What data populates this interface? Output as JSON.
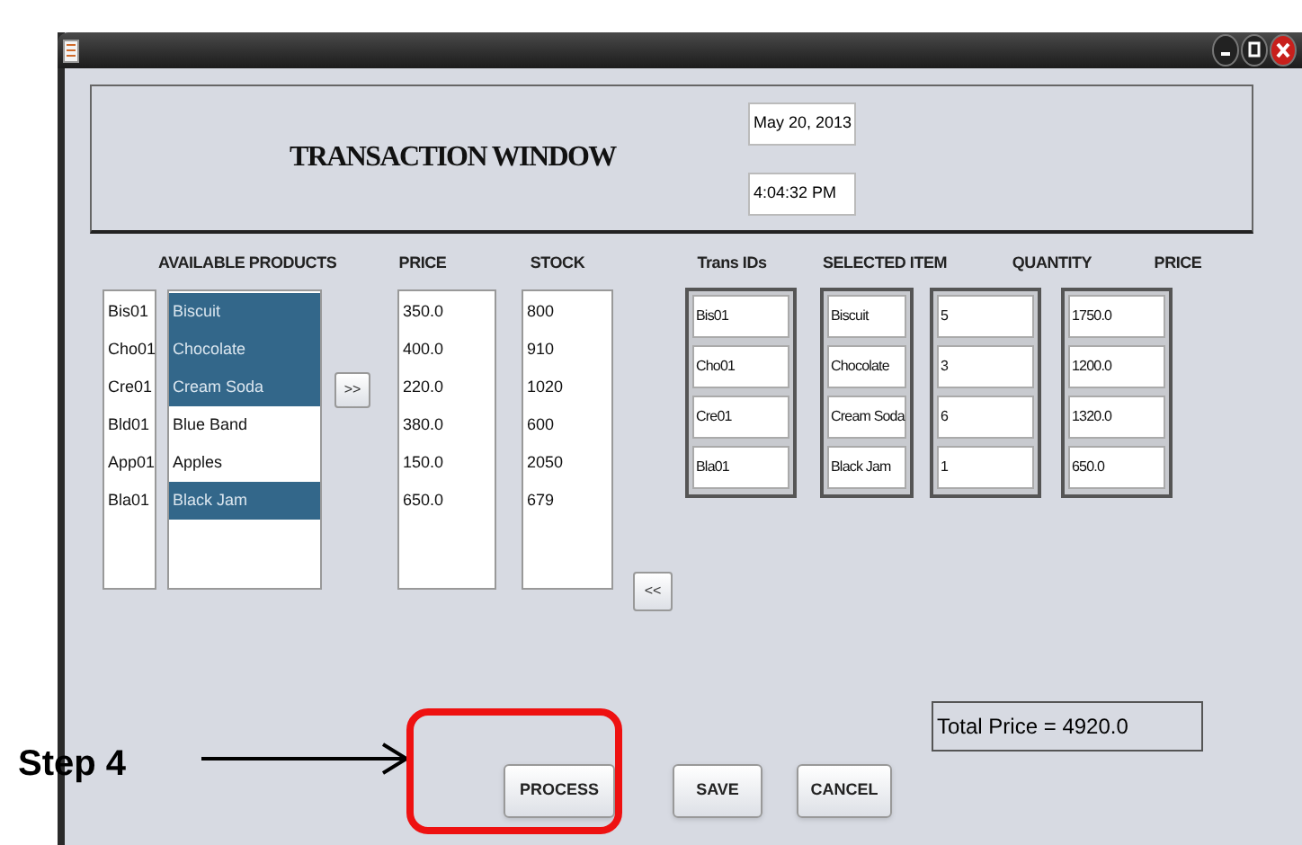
{
  "header": {
    "title": "TRANSACTION WINDOW",
    "date": "May 20, 2013",
    "time": "4:04:32 PM"
  },
  "headers": [
    "AVAILABLE PRODUCTS",
    "PRICE",
    "STOCK",
    "Trans IDs",
    "SELECTED ITEM",
    "QUANTITY",
    "PRICE"
  ],
  "products": [
    {
      "id": "Bis01",
      "name": "Biscuit",
      "selected": true,
      "price": "350.0",
      "stock": "800"
    },
    {
      "id": "Cho01",
      "name": "Chocolate",
      "selected": true,
      "price": "400.0",
      "stock": "910"
    },
    {
      "id": "Cre01",
      "name": "Cream Soda",
      "selected": true,
      "price": "220.0",
      "stock": "1020"
    },
    {
      "id": "Bld01",
      "name": "Blue Band",
      "selected": false,
      "price": "380.0",
      "stock": "600"
    },
    {
      "id": "App01",
      "name": "Apples",
      "selected": false,
      "price": "150.0",
      "stock": "2050"
    },
    {
      "id": "Bla01",
      "name": "Black Jam",
      "selected": true,
      "price": "650.0",
      "stock": "679"
    }
  ],
  "add_button": ">>",
  "remove_button": "<<",
  "transaction_rows": [
    {
      "id": "Bis01",
      "item": "Biscuit",
      "quantity": "5",
      "price": "1750.0"
    },
    {
      "id": "Cho01",
      "item": "Chocolate",
      "quantity": "3",
      "price": "1200.0"
    },
    {
      "id": "Cre01",
      "item": "Cream Soda",
      "quantity": "6",
      "price": "1320.0"
    },
    {
      "id": "Bla01",
      "item": "Black Jam",
      "quantity": "1",
      "price": "650.0"
    }
  ],
  "total": "Total Price = 4920.0",
  "buttons": [
    "PROCESS",
    "SAVE",
    "CANCEL"
  ],
  "annotation": {
    "label": "Step 4"
  }
}
